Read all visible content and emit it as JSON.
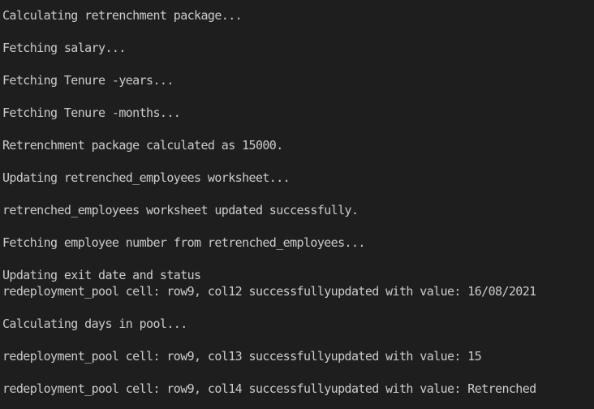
{
  "terminal": {
    "lines": [
      "Calculating retrenchment package...",
      "",
      "Fetching salary...",
      "",
      "Fetching Tenure -years...",
      "",
      "Fetching Tenure -months...",
      "",
      "Retrenchment package calculated as 15000.",
      "",
      "Updating retrenched_employees worksheet...",
      "",
      "retrenched_employees worksheet updated successfully.",
      "",
      "Fetching employee number from retrenched_employees...",
      "",
      "Updating exit date and status",
      "redeployment_pool cell: row9, col12 successfullyupdated with value: 16/08/2021",
      "",
      "Calculating days in pool...",
      "",
      "redeployment_pool cell: row9, col13 successfullyupdated with value: 15",
      "",
      "redeployment_pool cell: row9, col14 successfullyupdated with value: Retrenched"
    ]
  }
}
